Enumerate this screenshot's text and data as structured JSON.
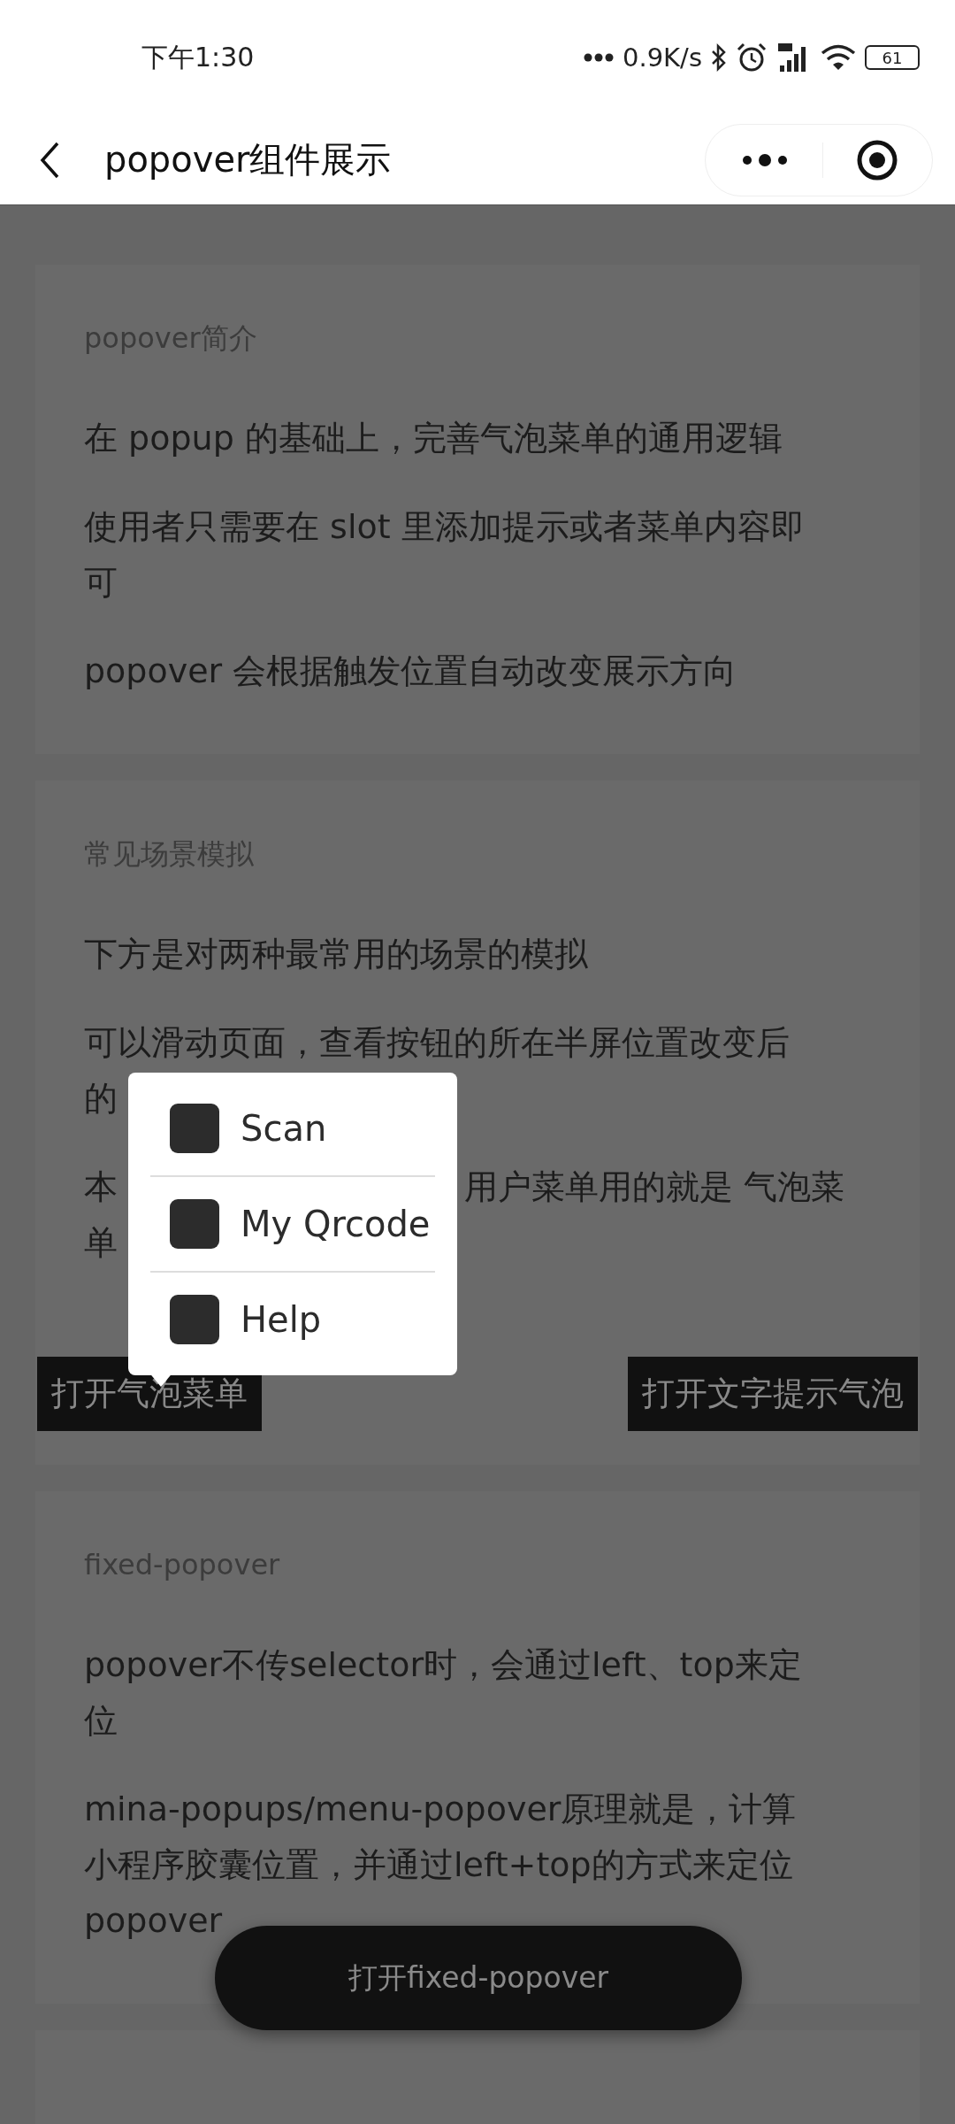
{
  "status_bar": {
    "time": "下午1:30",
    "network_speed": "0.9K/s",
    "battery": "61"
  },
  "nav": {
    "title": "popover组件展示"
  },
  "sections": [
    {
      "title": "popover简介",
      "paragraphs": [
        {
          "kind": "full",
          "text": "在 popup 的基础上，完善气泡菜单的通用逻辑"
        },
        {
          "kind": "full",
          "text": "使用者只需要在 slot 里添加提示或者菜单内容即可"
        },
        {
          "kind": "full",
          "text": "popover 会根据触发位置自动改变展示方向"
        }
      ]
    },
    {
      "title": "常见场景模拟",
      "paragraphs": [
        {
          "kind": "full",
          "text": "下方是对两种最常用的场景的模拟"
        },
        {
          "kind": "covered",
          "lines": [
            {
              "left": "可以滑动页面，查看按钮的所在半屏位置改变后"
            },
            {
              "left": "的"
            }
          ]
        },
        {
          "kind": "covered",
          "lines": [
            {
              "left": "本",
              "right": "用户菜单用的就是 气泡菜"
            },
            {
              "left": "单"
            }
          ]
        }
      ],
      "buttons": [
        {
          "label": "打开气泡菜单"
        },
        {
          "label": "打开文字提示气泡"
        }
      ]
    },
    {
      "title": "fixed-popover",
      "paragraphs": [
        {
          "kind": "full",
          "text": "popover不传selector时，会通过left、top来定位"
        },
        {
          "kind": "full",
          "text": "mina-popups/menu-popover原理就是，计算小程序胶囊位置，并通过left+top的方式来定位popover"
        }
      ]
    }
  ],
  "popover_menu": {
    "items": [
      {
        "label": "Scan"
      },
      {
        "label": "My Qrcode"
      },
      {
        "label": "Help"
      }
    ]
  },
  "fixed_button": {
    "label": "打开fixed-popover"
  }
}
